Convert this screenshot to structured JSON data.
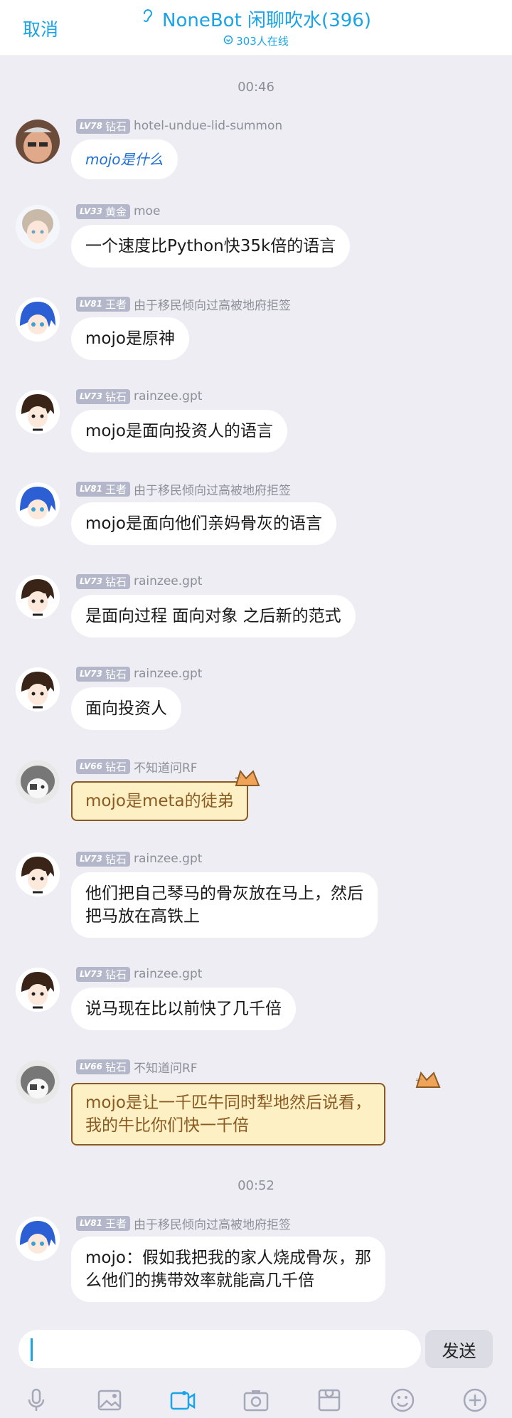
{
  "header": {
    "cancel": "取消",
    "title": "NoneBot 闲聊吹水(396)",
    "online": "303人在线"
  },
  "timestamps": [
    "00:46",
    "00:52"
  ],
  "messages": [
    {
      "level": "LV78",
      "rank": "钻石",
      "nick": "hotel-undue-lid-summon",
      "text": "mojo是什么"
    },
    {
      "level": "LV33",
      "rank": "黄金",
      "nick": "moe",
      "text": "一个速度比Python快35k倍的语言"
    },
    {
      "level": "LV81",
      "rank": "王者",
      "nick": "由于移民倾向过高被地府拒签",
      "text": "mojo是原神"
    },
    {
      "level": "LV73",
      "rank": "钻石",
      "nick": "rainzee.gpt",
      "text": "mojo是面向投资人的语言"
    },
    {
      "level": "LV81",
      "rank": "王者",
      "nick": "由于移民倾向过高被地府拒签",
      "text": "mojo是面向他们亲妈骨灰的语言"
    },
    {
      "level": "LV73",
      "rank": "钻石",
      "nick": "rainzee.gpt",
      "text": "是面向过程 面向对象 之后新的范式"
    },
    {
      "level": "LV73",
      "rank": "钻石",
      "nick": "rainzee.gpt",
      "text": "面向投资人"
    },
    {
      "level": "LV66",
      "rank": "钻石",
      "nick": "不知道问RF",
      "text": "mojo是meta的徒弟"
    },
    {
      "level": "LV73",
      "rank": "钻石",
      "nick": "rainzee.gpt",
      "text": "他们把自己琴马的骨灰放在马上，然后\n把马放在高铁上"
    },
    {
      "level": "LV73",
      "rank": "钻石",
      "nick": "rainzee.gpt",
      "text": "说马现在比以前快了几千倍"
    },
    {
      "level": "LV66",
      "rank": "钻石",
      "nick": "不知道问RF",
      "text": "mojo是让一千匹牛同时犁地然后说看，\n我的牛比你们快一千倍"
    },
    {
      "level": "LV81",
      "rank": "王者",
      "nick": "由于移民倾向过高被地府拒签",
      "text": "mojo：假如我把我的家人烧成骨灰，那\n么他们的携带效率就能高几千倍"
    }
  ],
  "composer": {
    "send": "发送"
  },
  "toolbar": [
    "mic-icon",
    "image-icon",
    "video-icon",
    "camera-icon",
    "folder-icon",
    "emoji-icon",
    "plus-icon"
  ],
  "colors": {
    "accent": "#19a4e8",
    "background": "#ededf3",
    "badge": "#b3b7c9",
    "cat_bubble": "#fdf0c4"
  }
}
